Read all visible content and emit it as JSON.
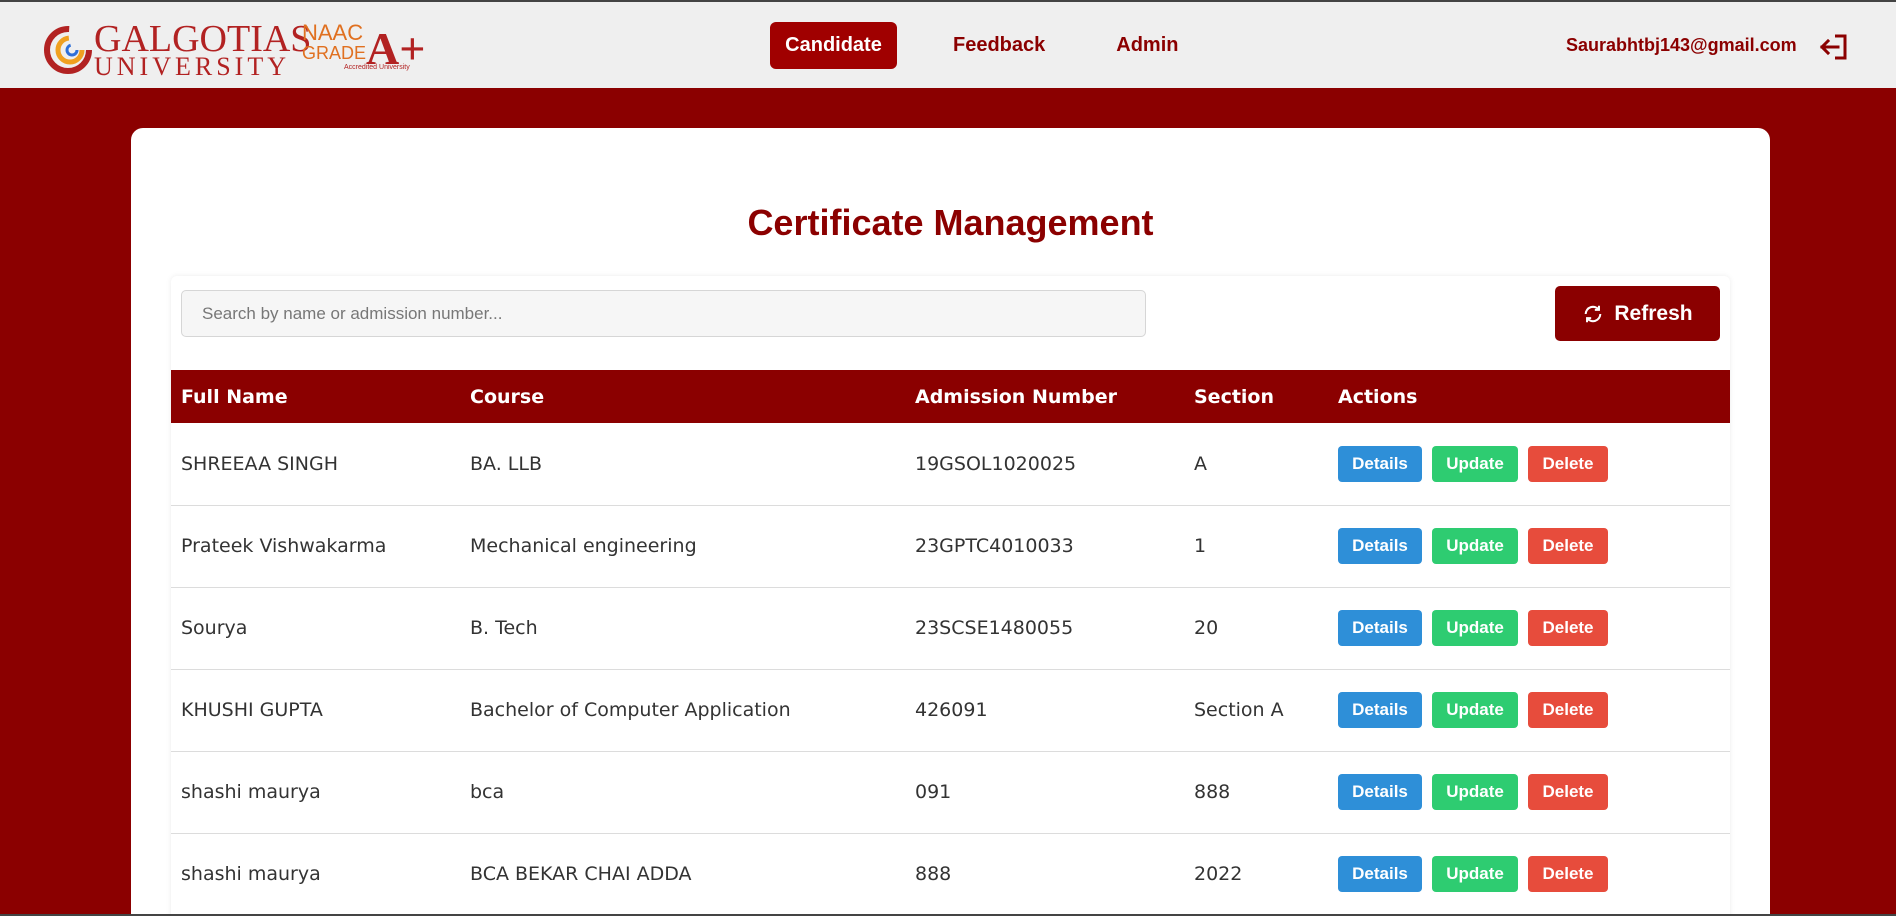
{
  "header": {
    "logo_line1": "GALGOTIAS",
    "logo_line2": "UNIVERSITY",
    "naac_line1": "NAAC",
    "naac_line2": "GRADE",
    "naac_grade": "A+",
    "naac_tagline": "Accredited University",
    "nav": [
      {
        "label": "Candidate",
        "active": true
      },
      {
        "label": "Feedback",
        "active": false
      },
      {
        "label": "Admin",
        "active": false
      }
    ],
    "user_email": "Saurabhtbj143@gmail.com"
  },
  "main": {
    "title": "Certificate Management",
    "search_placeholder": "Search by name or admission number...",
    "refresh_label": "Refresh",
    "columns": [
      "Full Name",
      "Course",
      "Admission Number",
      "Section",
      "Actions"
    ],
    "rows": [
      {
        "name": "SHREEAA SINGH",
        "course": "BA. LLB",
        "admission": "19GSOL1020025",
        "section": "A"
      },
      {
        "name": "Prateek Vishwakarma",
        "course": "Mechanical engineering",
        "admission": "23GPTC4010033",
        "section": "1"
      },
      {
        "name": "Sourya",
        "course": "B. Tech",
        "admission": "23SCSE1480055",
        "section": "20"
      },
      {
        "name": "KHUSHI GUPTA",
        "course": "Bachelor of Computer Application",
        "admission": "426091",
        "section": "Section A"
      },
      {
        "name": "shashi maurya",
        "course": "bca",
        "admission": "091",
        "section": "888"
      },
      {
        "name": "shashi maurya",
        "course": "BCA BEKAR CHAI ADDA",
        "admission": "888",
        "section": "2022"
      }
    ],
    "action_labels": {
      "details": "Details",
      "update": "Update",
      "delete": "Delete"
    }
  },
  "colors": {
    "brand": "#8b0000",
    "details": "#2e8fd8",
    "update": "#2ecc71",
    "delete": "#e74c3c"
  }
}
